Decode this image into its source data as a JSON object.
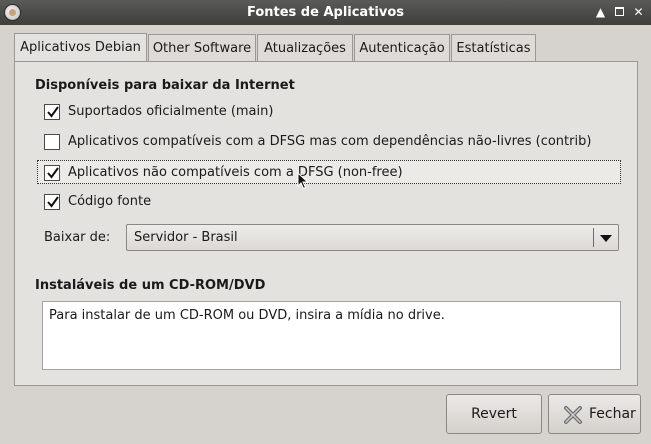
{
  "window": {
    "title": "Fontes de Aplicativos",
    "controls": [
      "roll-up",
      "maximize",
      "close"
    ]
  },
  "tabs": [
    {
      "label": "Aplicativos Debian",
      "active": true
    },
    {
      "label": "Other Software",
      "active": false
    },
    {
      "label": "Atualizações",
      "active": false
    },
    {
      "label": "Autenticação",
      "active": false
    },
    {
      "label": "Estatísticas",
      "active": false
    }
  ],
  "internet": {
    "title": "Disponíveis para baixar da Internet",
    "options": [
      {
        "label": "Suportados oficialmente (main)",
        "checked": true
      },
      {
        "label": "Aplicativos compatíveis com a DFSG mas com dependências não-livres (contrib)",
        "checked": false
      },
      {
        "label": "Aplicativos não compatíveis com a DFSG (non-free)",
        "checked": true
      },
      {
        "label": "Código fonte",
        "checked": true
      }
    ],
    "download_label": "Baixar de:",
    "download_value": "Servidor - Brasil"
  },
  "cdrom": {
    "title": "Instaláveis de um CD-ROM/DVD",
    "message": "Para instalar de um CD-ROM ou DVD, insira a mídia no drive."
  },
  "buttons": {
    "revert": "Revert",
    "close": "Fechar"
  },
  "icons": {
    "close_button_icon": "x-icon",
    "check_color": "#111111"
  }
}
